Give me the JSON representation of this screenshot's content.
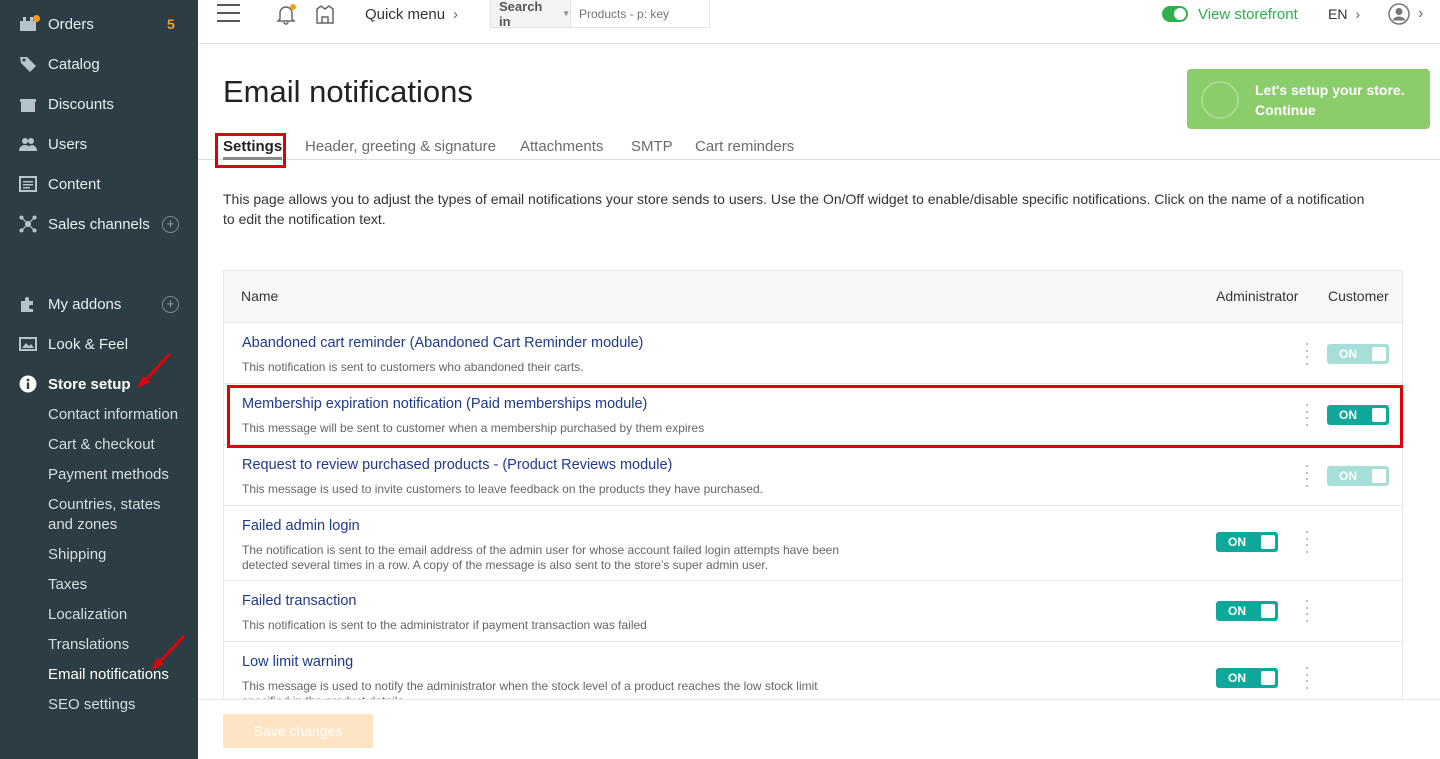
{
  "sidebar": {
    "orders": {
      "label": "Orders",
      "badge": "5"
    },
    "catalog": "Catalog",
    "discounts": "Discounts",
    "users": "Users",
    "content": "Content",
    "sales_channels": "Sales channels",
    "my_addons": "My addons",
    "look_feel": "Look & Feel",
    "store_setup": "Store setup",
    "store_setup_items": [
      "Contact information",
      "Cart & checkout",
      "Payment methods",
      "Countries, states and zones",
      "Shipping",
      "Taxes",
      "Localization",
      "Translations",
      "Email notifications",
      "SEO settings"
    ]
  },
  "topbar": {
    "quick_menu": "Quick menu",
    "search_in": "Search in",
    "search_placeholder": "Products - p: key",
    "view_storefront": "View storefront",
    "lang": "EN"
  },
  "page": {
    "title": "Email notifications",
    "setup_card": {
      "line1": "Let's setup your store.",
      "line2": "Continue"
    },
    "tabs": [
      "Settings",
      "Header, greeting & signature",
      "Attachments",
      "SMTP",
      "Cart reminders"
    ],
    "description": "This page allows you to adjust the types of email notifications your store sends to users. Use the On/Off widget to enable/disable specific notifications. Click on the name of a notification to edit the notification text."
  },
  "table": {
    "headers": {
      "name": "Name",
      "administrator": "Administrator",
      "customer": "Customer"
    },
    "rows": [
      {
        "title": "Abandoned cart reminder (Abandoned Cart Reminder module)",
        "desc": "This notification is sent to customers who abandoned their carts.",
        "customer": "ON"
      },
      {
        "title": "Membership expiration notification (Paid memberships module)",
        "desc": "This message will be sent to customer when a membership purchased by them expires",
        "customer": "ON"
      },
      {
        "title": "Request to review purchased products - (Product Reviews module)",
        "desc": "This message is used to invite customers to leave feedback on the products they have purchased.",
        "customer": "ON"
      },
      {
        "title": "Failed admin login",
        "desc": "The notification is sent to the email address of the admin user for whose account failed login attempts have been detected several times in a row. A copy of the message is also sent to the store’s super admin user.",
        "admin": "ON"
      },
      {
        "title": "Failed transaction",
        "desc": "This notification is sent to the administrator if payment transaction was failed",
        "admin": "ON"
      },
      {
        "title": "Low limit warning",
        "desc": "This message is used to notify the administrator when the stock level of a product reaches the low stock limit specified in the product details.",
        "admin": "ON"
      }
    ]
  },
  "footer": {
    "save_label": "Save changes"
  },
  "colors": {
    "sidebar_bg": "#2c3e44",
    "accent_teal": "#11a89c",
    "accent_green": "#2eb04b",
    "badge_orange": "#f79c1e",
    "highlight_red": "#e0000b",
    "link_blue": "#1e3a8a"
  },
  "icons": [
    "orders-icon",
    "catalog-icon",
    "discounts-icon",
    "users-icon",
    "content-icon",
    "sales-channels-icon",
    "addons-icon",
    "look-feel-icon",
    "info-icon",
    "hamburger-icon",
    "bell-icon",
    "storefront-icon",
    "user-icon"
  ]
}
